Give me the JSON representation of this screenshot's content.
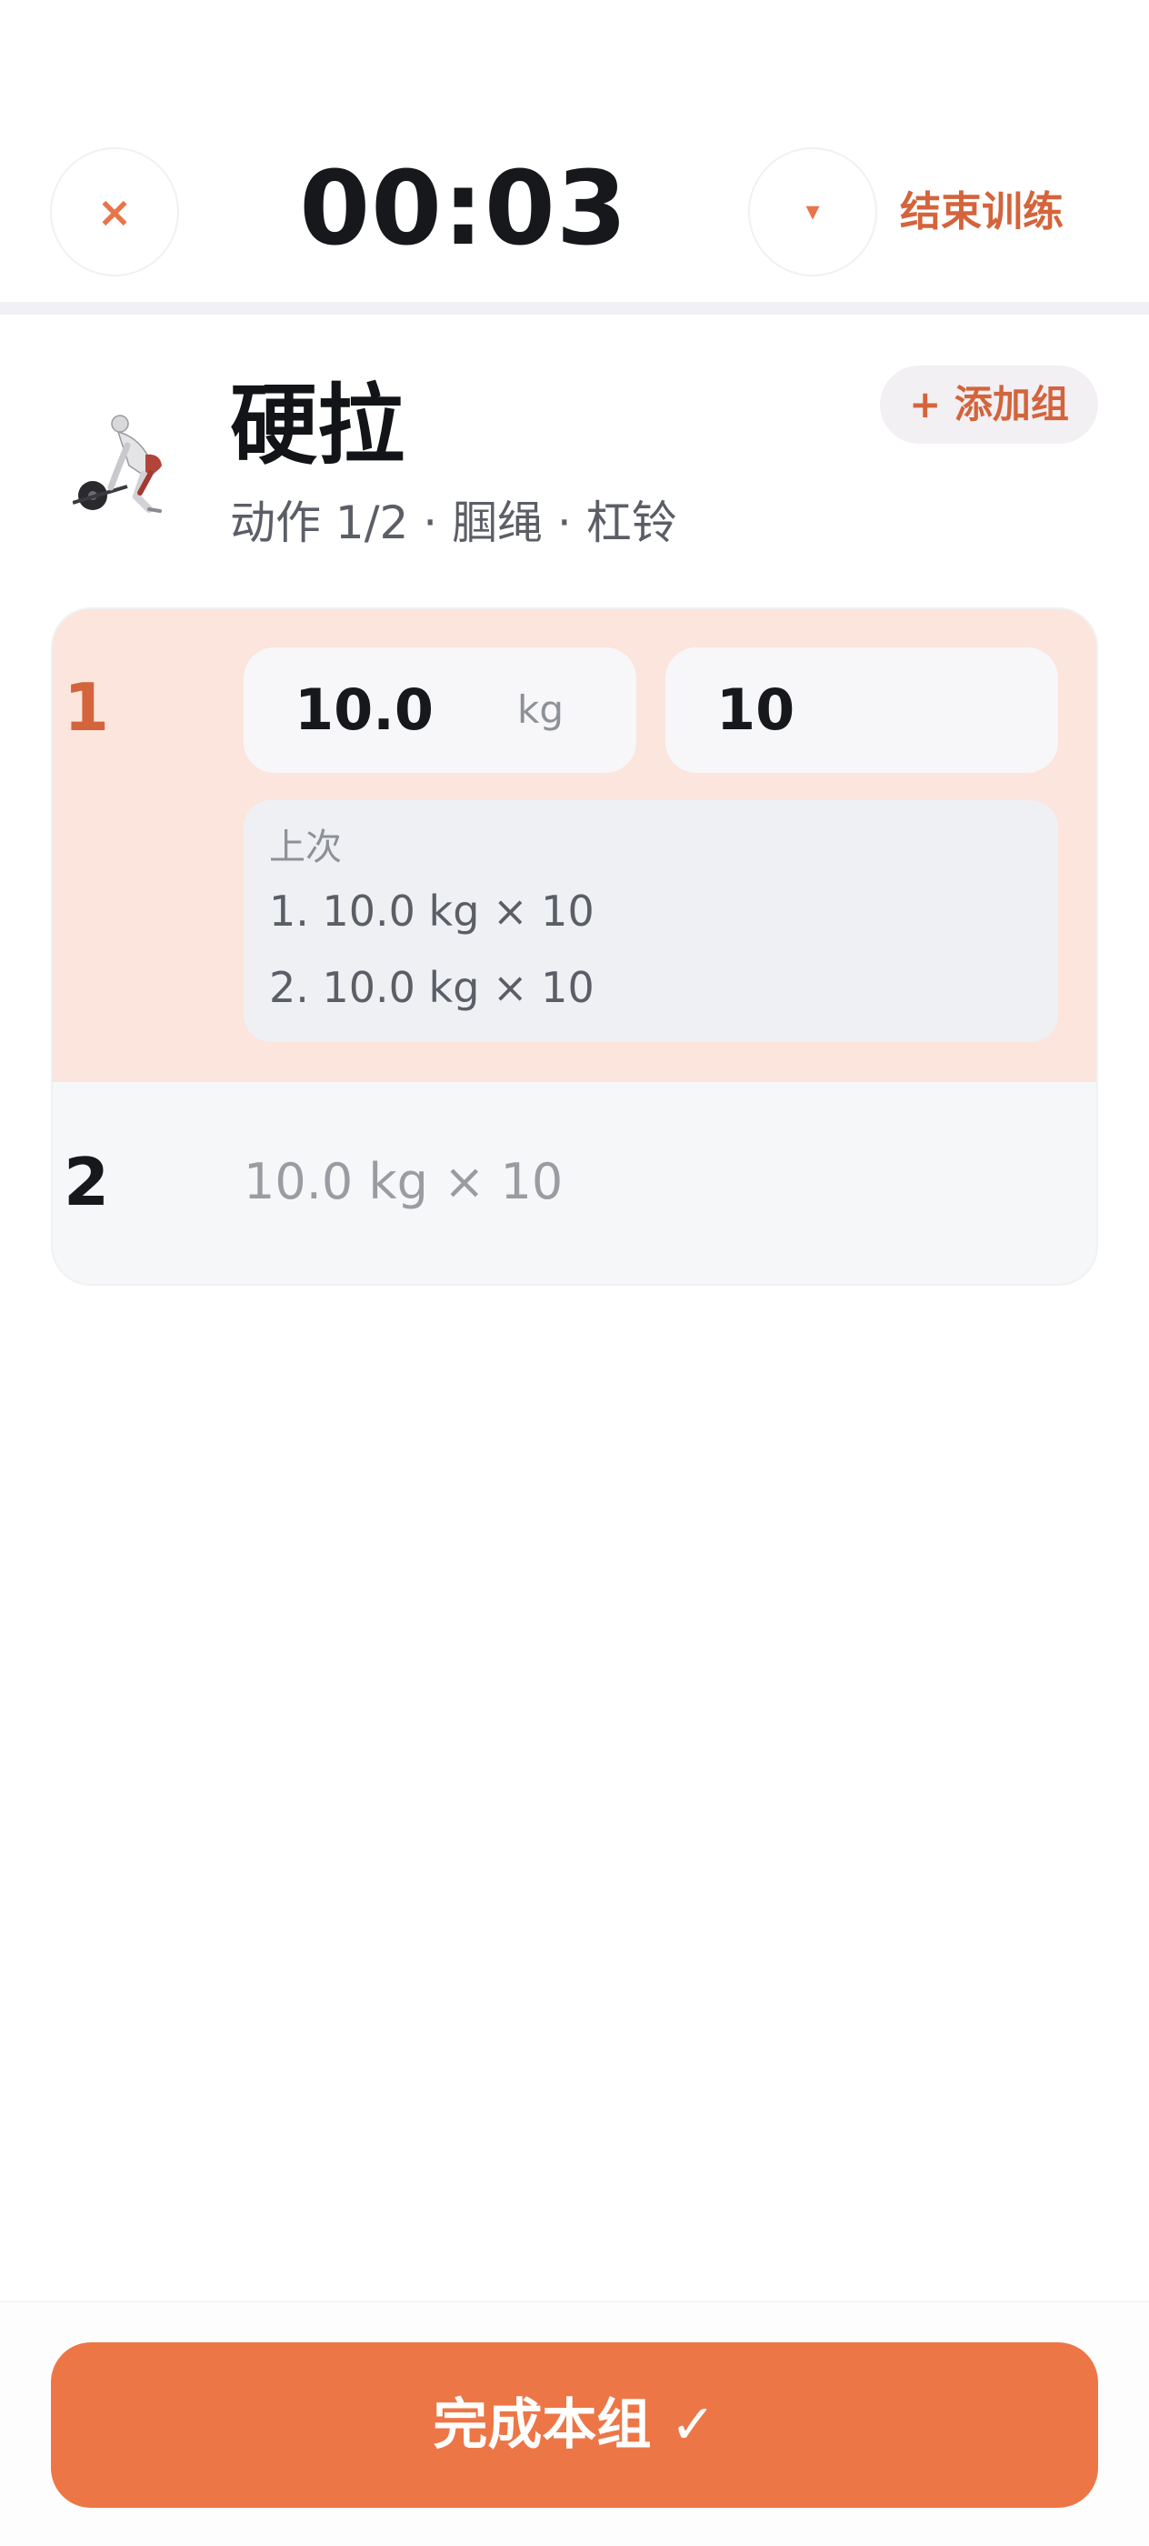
{
  "topbar": {
    "close_icon": "×",
    "timer": "00:03",
    "collapse_icon": "▾",
    "end_label": "结束训练"
  },
  "exercise": {
    "thumbnail_icon": "deadlift-figure-icon",
    "title": "硬拉",
    "meta": "动作 1/2 · 腘绳 · 杠铃",
    "add_set_label": "+ 添加组"
  },
  "sets": {
    "active": {
      "number": "1",
      "weight": "10.0",
      "weight_unit": "kg",
      "reps": "10",
      "previous_title": "上次",
      "previous": [
        "1. 10.0 kg × 10",
        "2. 10.0 kg × 10"
      ]
    },
    "idle": {
      "number": "2",
      "summary": "10.0 kg × 10"
    }
  },
  "footer": {
    "complete_label": "完成本组 ✓"
  },
  "colors": {
    "accent": "#ed7647",
    "accent_text": "#d3643c",
    "active_row": "#fbe5dc"
  }
}
